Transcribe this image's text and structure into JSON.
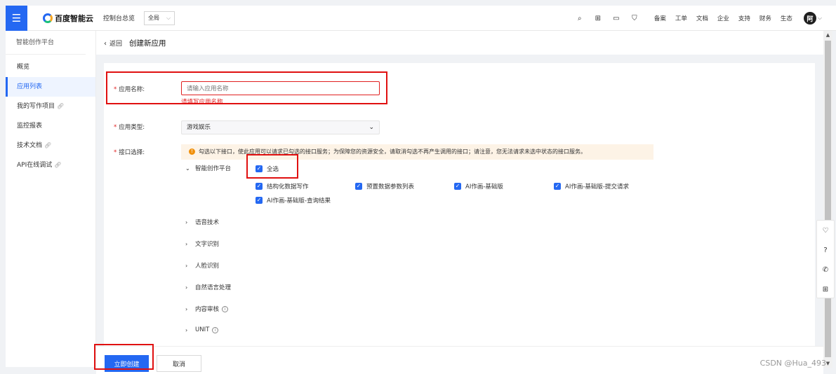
{
  "header": {
    "logo_text": "百度智能云",
    "console_link": "控制台总览",
    "region": "全局",
    "links": [
      "备案",
      "工单",
      "文档",
      "企业",
      "支持",
      "财务",
      "生态"
    ],
    "avatar_text": "阿"
  },
  "sidebar": {
    "title": "智能创作平台",
    "items": [
      {
        "label": "概览"
      },
      {
        "label": "应用列表"
      },
      {
        "label": "我的写作项目"
      },
      {
        "label": "监控报表"
      },
      {
        "label": "技术文档"
      },
      {
        "label": "API在线调试"
      }
    ]
  },
  "breadcrumb": {
    "back": "返回",
    "title": "创建新应用"
  },
  "form": {
    "name_label": "应用名称:",
    "name_placeholder": "请输入应用名称",
    "name_error": "请填写应用名称",
    "type_label": "应用类型:",
    "type_value": "游戏娱乐",
    "api_label": "接口选择:",
    "notice": "勾选以下接口，使此应用可以请求已勾选的接口服务；为保障您的资源安全，请取消勾选不再产生调用的接口；请注意，您无法请求未选中状态的接口服务。",
    "expanded_group": "智能创作平台",
    "select_all": "全选",
    "checkboxes": [
      "结构化数据写作",
      "预置数据参数列表",
      "AI作画-基础版",
      "AI作画-基础版-提交请求",
      "AI作画-基础版-查询结果"
    ],
    "collapsed_groups": [
      "语音技术",
      "文字识别",
      "人脸识别",
      "自然语言处理",
      "内容审核",
      "UNIT"
    ]
  },
  "footer": {
    "create_button": "立即创建",
    "cancel_button": "取消"
  },
  "watermark": "CSDN @Hua_493",
  "colors": {
    "primary": "#2468f2",
    "error": "#e02020",
    "annotation": "#e01010",
    "notice_bg": "#fdf3e6"
  },
  "icons": {
    "menu": "menu-icon",
    "search": "search-icon",
    "cart": "cart-icon",
    "link": "link-icon",
    "info": "info-icon",
    "warning": "warning-icon"
  }
}
